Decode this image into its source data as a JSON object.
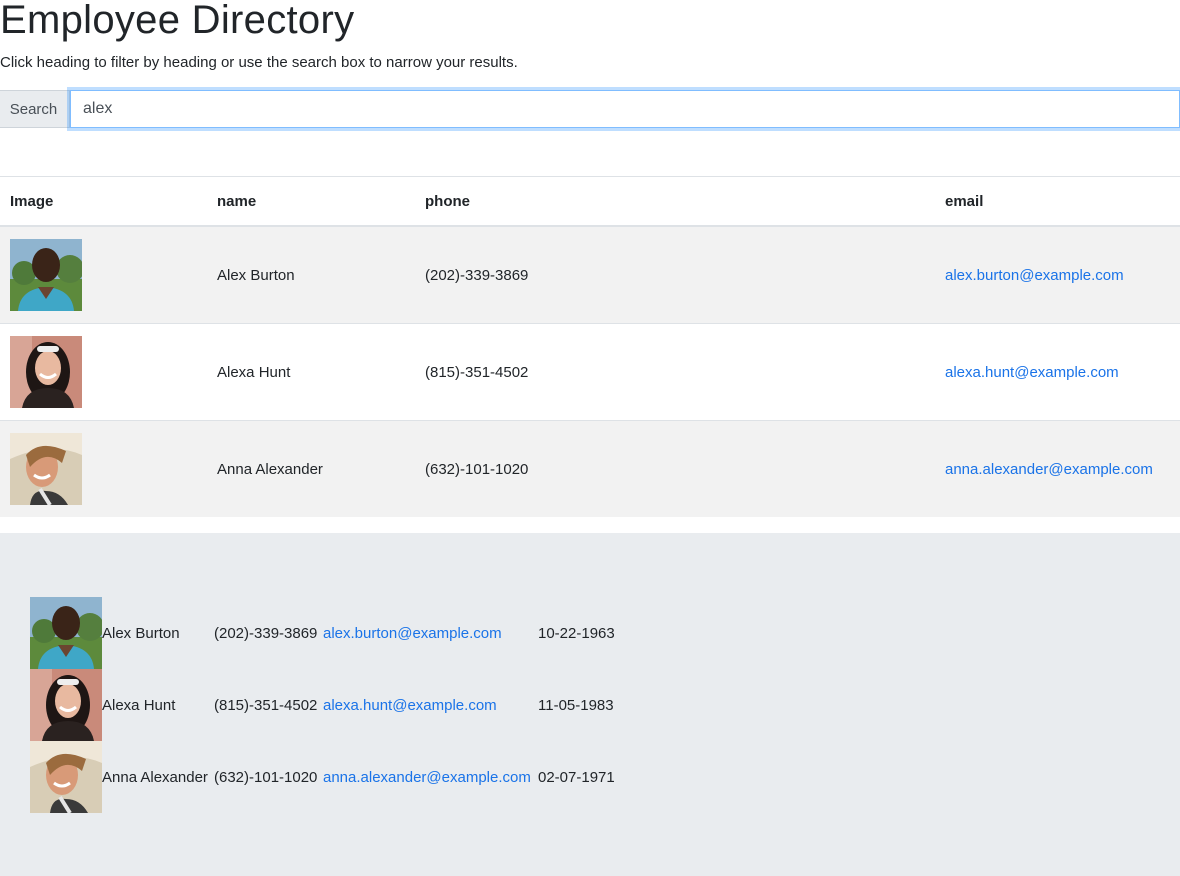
{
  "page": {
    "title": "Employee Directory",
    "subtitle": "Click heading to filter by heading or use the search box to narrow your results."
  },
  "search": {
    "label": "Search",
    "value": "alex"
  },
  "table": {
    "headers": {
      "image": "Image",
      "name": "name",
      "phone": "phone",
      "email": "email"
    },
    "rows": [
      {
        "name": "Alex Burton",
        "phone": "(202)-339-3869",
        "email": "alex.burton@example.com",
        "avatar": "person-photo-1"
      },
      {
        "name": "Alexa Hunt",
        "phone": "(815)-351-4502",
        "email": "alexa.hunt@example.com",
        "avatar": "person-photo-2"
      },
      {
        "name": "Anna Alexander",
        "phone": "(632)-101-1020",
        "email": "anna.alexander@example.com",
        "avatar": "person-photo-3"
      }
    ]
  },
  "cards": [
    {
      "name": "Alex Burton",
      "phone": "(202)-339-3869",
      "email": "alex.burton@example.com",
      "dob": "10-22-1963"
    },
    {
      "name": "Alexa Hunt",
      "phone": "(815)-351-4502",
      "email": "alexa.hunt@example.com",
      "dob": "11-05-1983"
    },
    {
      "name": "Anna Alexander",
      "phone": "(632)-101-1020",
      "email": "anna.alexander@example.com",
      "dob": "02-07-1971"
    }
  ],
  "colors": {
    "link": "#1a73e8",
    "stripe": "#f2f2f2",
    "jumbotron": "#e9ecef",
    "focus": "#80bdff"
  }
}
